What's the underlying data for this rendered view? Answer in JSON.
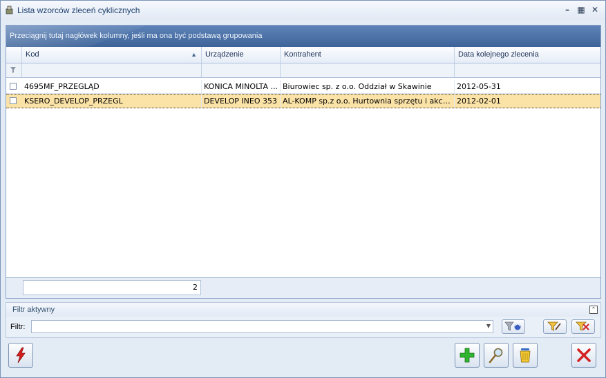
{
  "window": {
    "title": "Lista wzorców zleceń cyklicznych",
    "icon": "app-icon",
    "controls": [
      "minimize-icon",
      "maximize-icon",
      "close-icon"
    ]
  },
  "grid": {
    "group_hint": "Przeciągnij tutaj nagłówek kolumny, jeśli ma ona być podstawą grupowania",
    "columns": [
      "Kod",
      "Urządzenie",
      "Kontrahent",
      "Data kolejnego zlecenia"
    ],
    "sort": {
      "column": "Kod",
      "direction": "ascending"
    },
    "rows": [
      {
        "kod": "4695MF_PRZEGLĄD",
        "urzadzenie": "KONICA MINOLTA ...",
        "kontrahent": "Biurowiec sp. z o.o. Oddział w Skawinie",
        "data": "2012-05-31",
        "checked": false,
        "selected": false
      },
      {
        "kod": "KSERO_DEVELOP_PRZEGL",
        "urzadzenie": "DEVELOP INEO 353",
        "kontrahent": "AL-KOMP sp.z o.o. Hurtownia sprzętu i akcesorió...",
        "data": "2012-02-01",
        "checked": false,
        "selected": true
      }
    ],
    "footer_count": "2"
  },
  "filter_panel": {
    "header": "Filtr aktywny",
    "label": "Filtr:",
    "value": ""
  },
  "colors": {
    "group_panel": "#4a70a8",
    "selected_row": "#fbe3a8",
    "window_bg": "#e3ebf5"
  }
}
